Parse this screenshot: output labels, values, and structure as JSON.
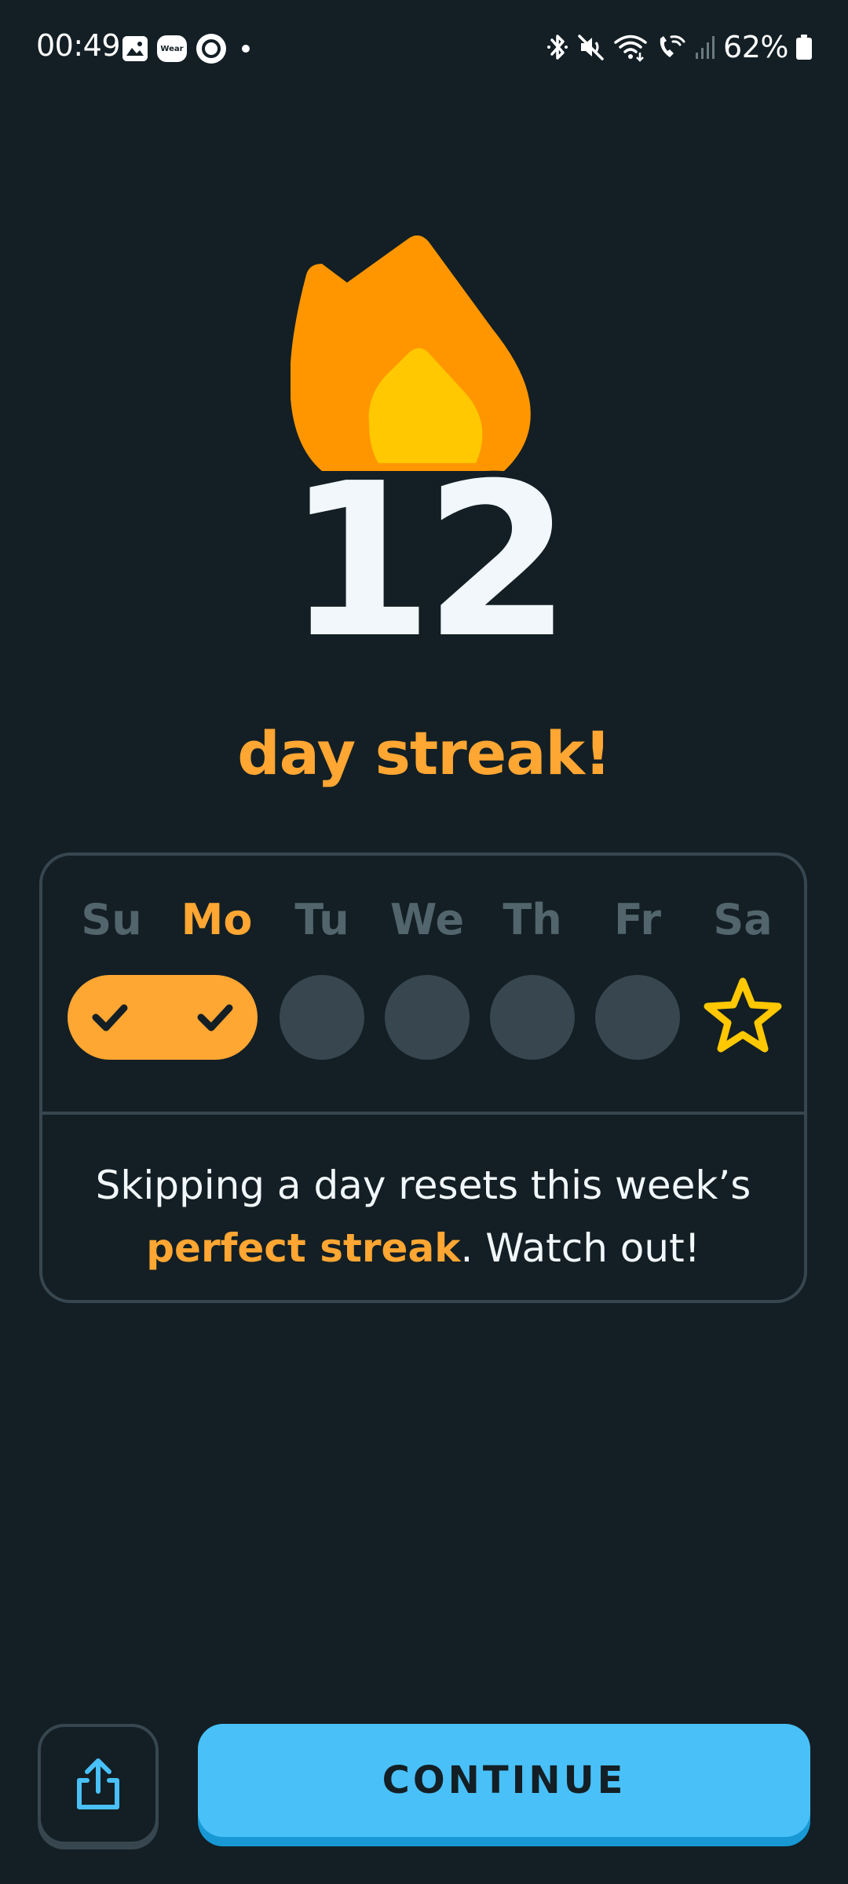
{
  "status_bar": {
    "time": "00:49",
    "notification_icons": [
      "gallery-icon",
      "wear-icon",
      "ring-app-icon",
      "dot-icon"
    ],
    "wear_label": "Wear",
    "system_icons": [
      "bluetooth-icon",
      "mute-icon",
      "wifi-icon",
      "wifi-calling-icon",
      "signal-icon",
      "battery-icon"
    ],
    "battery_percent": "62%"
  },
  "streak": {
    "count": "12",
    "label": "day streak!",
    "icon": "flame-icon"
  },
  "week": {
    "days": [
      {
        "label": "Su",
        "state": "done"
      },
      {
        "label": "Mo",
        "state": "done",
        "today": true
      },
      {
        "label": "Tu",
        "state": "pending"
      },
      {
        "label": "We",
        "state": "pending"
      },
      {
        "label": "Th",
        "state": "pending"
      },
      {
        "label": "Fr",
        "state": "pending"
      },
      {
        "label": "Sa",
        "state": "goal"
      }
    ],
    "warning_prefix": "Skipping a day resets this week’s",
    "warning_highlight": "perfect streak",
    "warning_suffix": ". Watch out!"
  },
  "actions": {
    "share_icon": "share-icon",
    "continue_label": "CONTINUE"
  },
  "colors": {
    "background": "#131f24",
    "accent_orange": "#ffa633",
    "flame_outer": "#ff9600",
    "flame_inner": "#ffc800",
    "continue_blue": "#49c0f8",
    "star_yellow": "#ffc800",
    "muted": "#52656d",
    "border": "#37464f"
  }
}
